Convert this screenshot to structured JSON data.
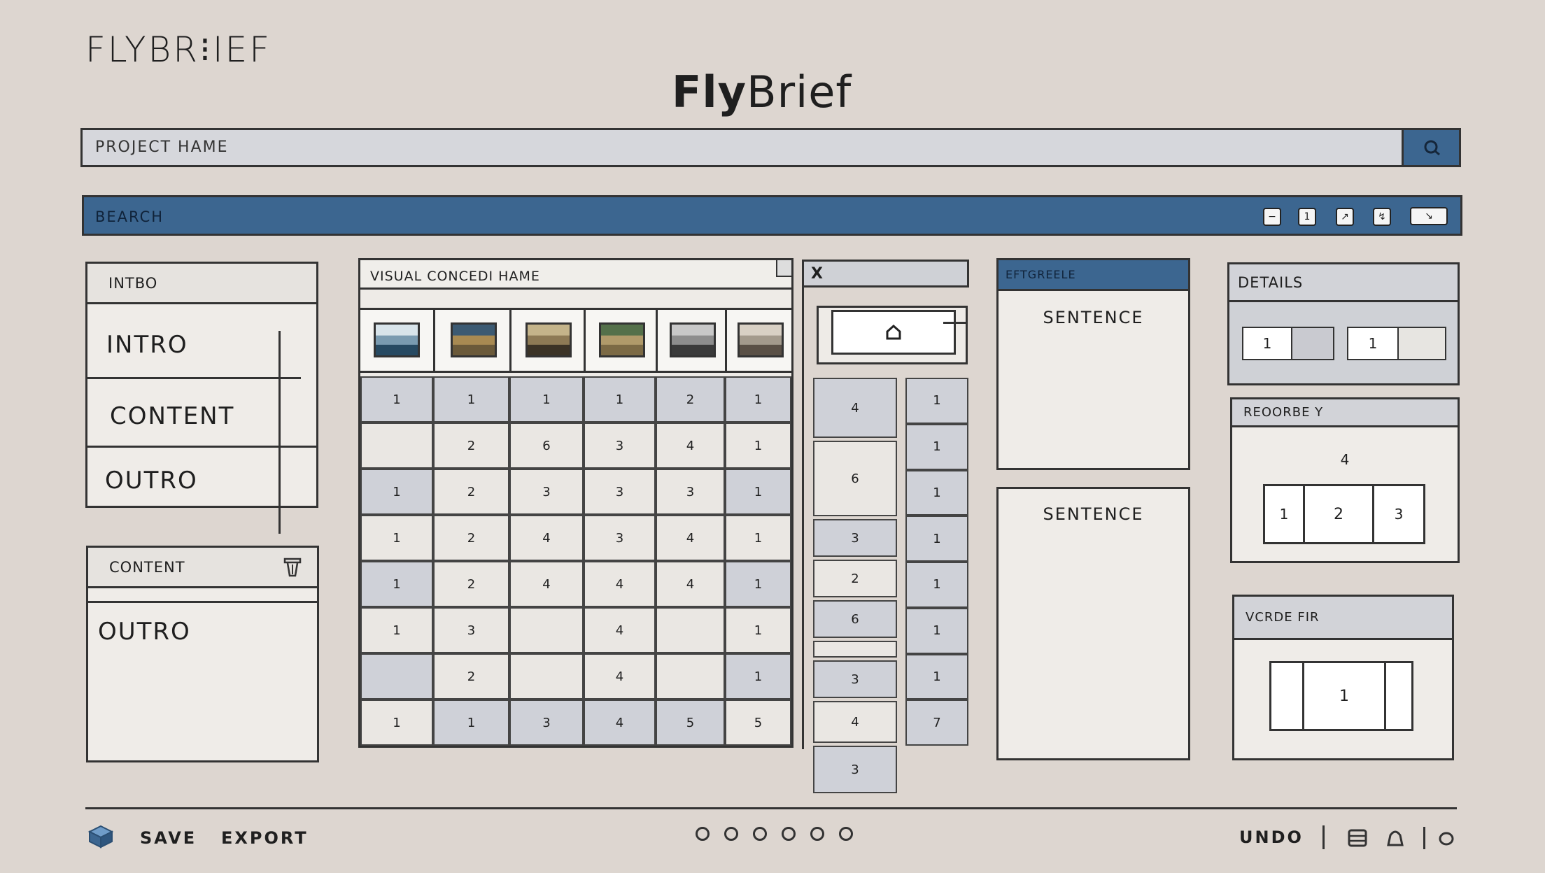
{
  "app": {
    "logo_text": "FLYBR⁝IEF",
    "title_bold": "Fly",
    "title_light": "Brief"
  },
  "project_bar": {
    "placeholder": "PROJECT HAME",
    "search_icon": "search-icon"
  },
  "search_bar": {
    "label": "BEARCH",
    "tool_glyphs": [
      "−",
      "1",
      "↗",
      "↯",
      "↘"
    ]
  },
  "structure_panel": {
    "header": "INTBO",
    "items": [
      "INTRO",
      "CONTENT",
      "OUTRO"
    ]
  },
  "content_panel": {
    "header": "CONTENT",
    "body": "OUTRO"
  },
  "storyboard": {
    "header": "VISUAL CONCEDI HAME",
    "columns": [
      [
        "1",
        "",
        "1",
        "1",
        "1",
        "1",
        "",
        "1"
      ],
      [
        "1",
        "2",
        "2",
        "2",
        "2",
        "3",
        "2",
        "1"
      ],
      [
        "1",
        "6",
        "3",
        "4",
        "4",
        "",
        "",
        "3"
      ],
      [
        "1",
        "3",
        "3",
        "3",
        "4",
        "4",
        "4",
        "4"
      ],
      [
        "2",
        "4",
        "3",
        "4",
        "4",
        "",
        "",
        "5"
      ],
      [
        "1",
        "1",
        "1",
        "1",
        "1",
        "1",
        "1",
        "5"
      ]
    ]
  },
  "mini_panel": {
    "close_label": "X",
    "col_a": [
      "4",
      "6",
      "3",
      "2",
      "6",
      "",
      "3",
      "4",
      "3"
    ],
    "col_b": [
      "1",
      "1",
      "1",
      "1",
      "1",
      "1",
      "1",
      "7"
    ]
  },
  "sentence_panel": {
    "header": "EFTGREELE",
    "sentence_1": "SENTENCE",
    "sentence_2": "SENTENCE"
  },
  "details_panel": {
    "header": "DETAILS",
    "values": [
      "1",
      "1"
    ]
  },
  "reorder_panel": {
    "header": "REOORBE Y",
    "top_value": "4",
    "values": [
      "1",
      "2",
      "3"
    ]
  },
  "voice_panel": {
    "header": "VCRDE FIR",
    "value": "1"
  },
  "footer": {
    "save_label": "SAVE",
    "export_label": "EXPORT",
    "undo_label": "UNDO",
    "dots": 6
  },
  "colors": {
    "background": "#ddd6d0",
    "accent_blue": "#3c6690",
    "panel_grey": "#cfd1d8"
  }
}
